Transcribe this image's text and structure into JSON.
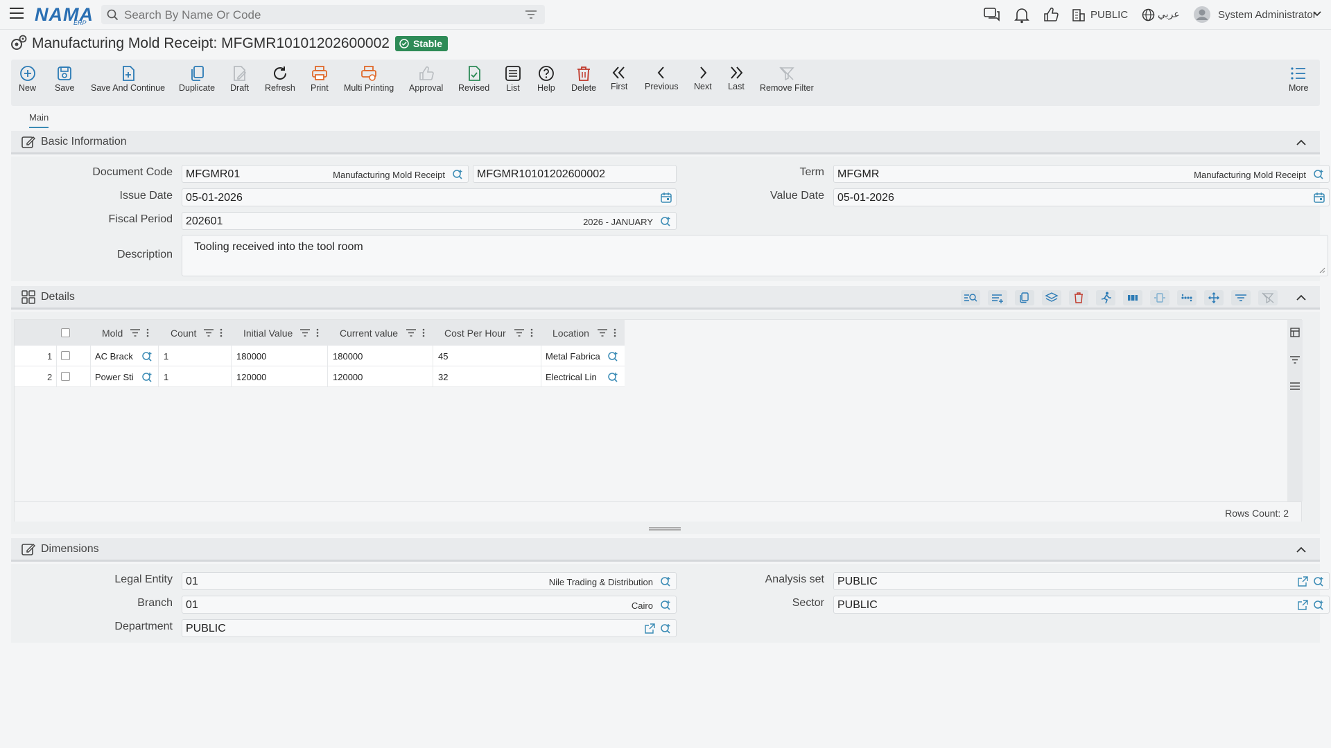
{
  "header": {
    "logo_text": "NAMA",
    "logo_sub": "ERP",
    "search_placeholder": "Search By Name Or Code",
    "org": "PUBLIC",
    "language": "عربي",
    "user": "System Administrator"
  },
  "page": {
    "title": "Manufacturing Mold Receipt: MFGMR10101202600002",
    "status": "Stable"
  },
  "toolbar": {
    "new": "New",
    "save": "Save",
    "save_continue": "Save And Continue",
    "duplicate": "Duplicate",
    "draft": "Draft",
    "refresh": "Refresh",
    "print": "Print",
    "multi_printing": "Multi Printing",
    "approval": "Approval",
    "revised": "Revised",
    "list": "List",
    "help": "Help",
    "delete": "Delete",
    "first": "First",
    "previous": "Previous",
    "next": "Next",
    "last": "Last",
    "remove_filter": "Remove Filter",
    "more": "More"
  },
  "tabs": {
    "main": "Main"
  },
  "basic": {
    "section_title": "Basic Information",
    "document_code_label": "Document Code",
    "document_code": "MFGMR01",
    "document_code_desc": "Manufacturing Mold Receipt",
    "document_number": "MFGMR10101202600002",
    "term_label": "Term",
    "term": "MFGMR",
    "term_desc": "Manufacturing Mold Receipt",
    "issue_date_label": "Issue Date",
    "issue_date": "05-01-2026",
    "value_date_label": "Value Date",
    "value_date": "05-01-2026",
    "fiscal_period_label": "Fiscal Period",
    "fiscal_period": "202601",
    "fiscal_period_desc": "2026 - JANUARY",
    "description_label": "Description",
    "description": "Tooling received into the tool room"
  },
  "details": {
    "section_title": "Details",
    "columns": {
      "mold": "Mold",
      "count": "Count",
      "initial_value": "Initial Value",
      "current_value": "Current value",
      "cost_per_hour": "Cost Per Hour",
      "location": "Location"
    },
    "rows": [
      {
        "num": "1",
        "mold": "AC Brack",
        "count": "1",
        "initial_value": "180000",
        "current_value": "180000",
        "cost_per_hour": "45",
        "location": "Metal Fabrica"
      },
      {
        "num": "2",
        "mold": "Power Sti",
        "count": "1",
        "initial_value": "120000",
        "current_value": "120000",
        "cost_per_hour": "32",
        "location": "Electrical Lin"
      }
    ],
    "rows_count": "Rows Count: 2"
  },
  "dimensions": {
    "section_title": "Dimensions",
    "legal_entity_label": "Legal Entity",
    "legal_entity": "01",
    "legal_entity_desc": "Nile Trading & Distribution",
    "analysis_set_label": "Analysis set",
    "analysis_set": "PUBLIC",
    "branch_label": "Branch",
    "branch": "01",
    "branch_desc": "Cairo",
    "sector_label": "Sector",
    "sector": "PUBLIC",
    "department_label": "Department",
    "department": "PUBLIC"
  },
  "colors": {
    "accent": "#3a8bb5",
    "stable": "#2e8b57",
    "print": "#e06a2b",
    "delete": "#c0392b",
    "revised": "#2e8b57"
  }
}
